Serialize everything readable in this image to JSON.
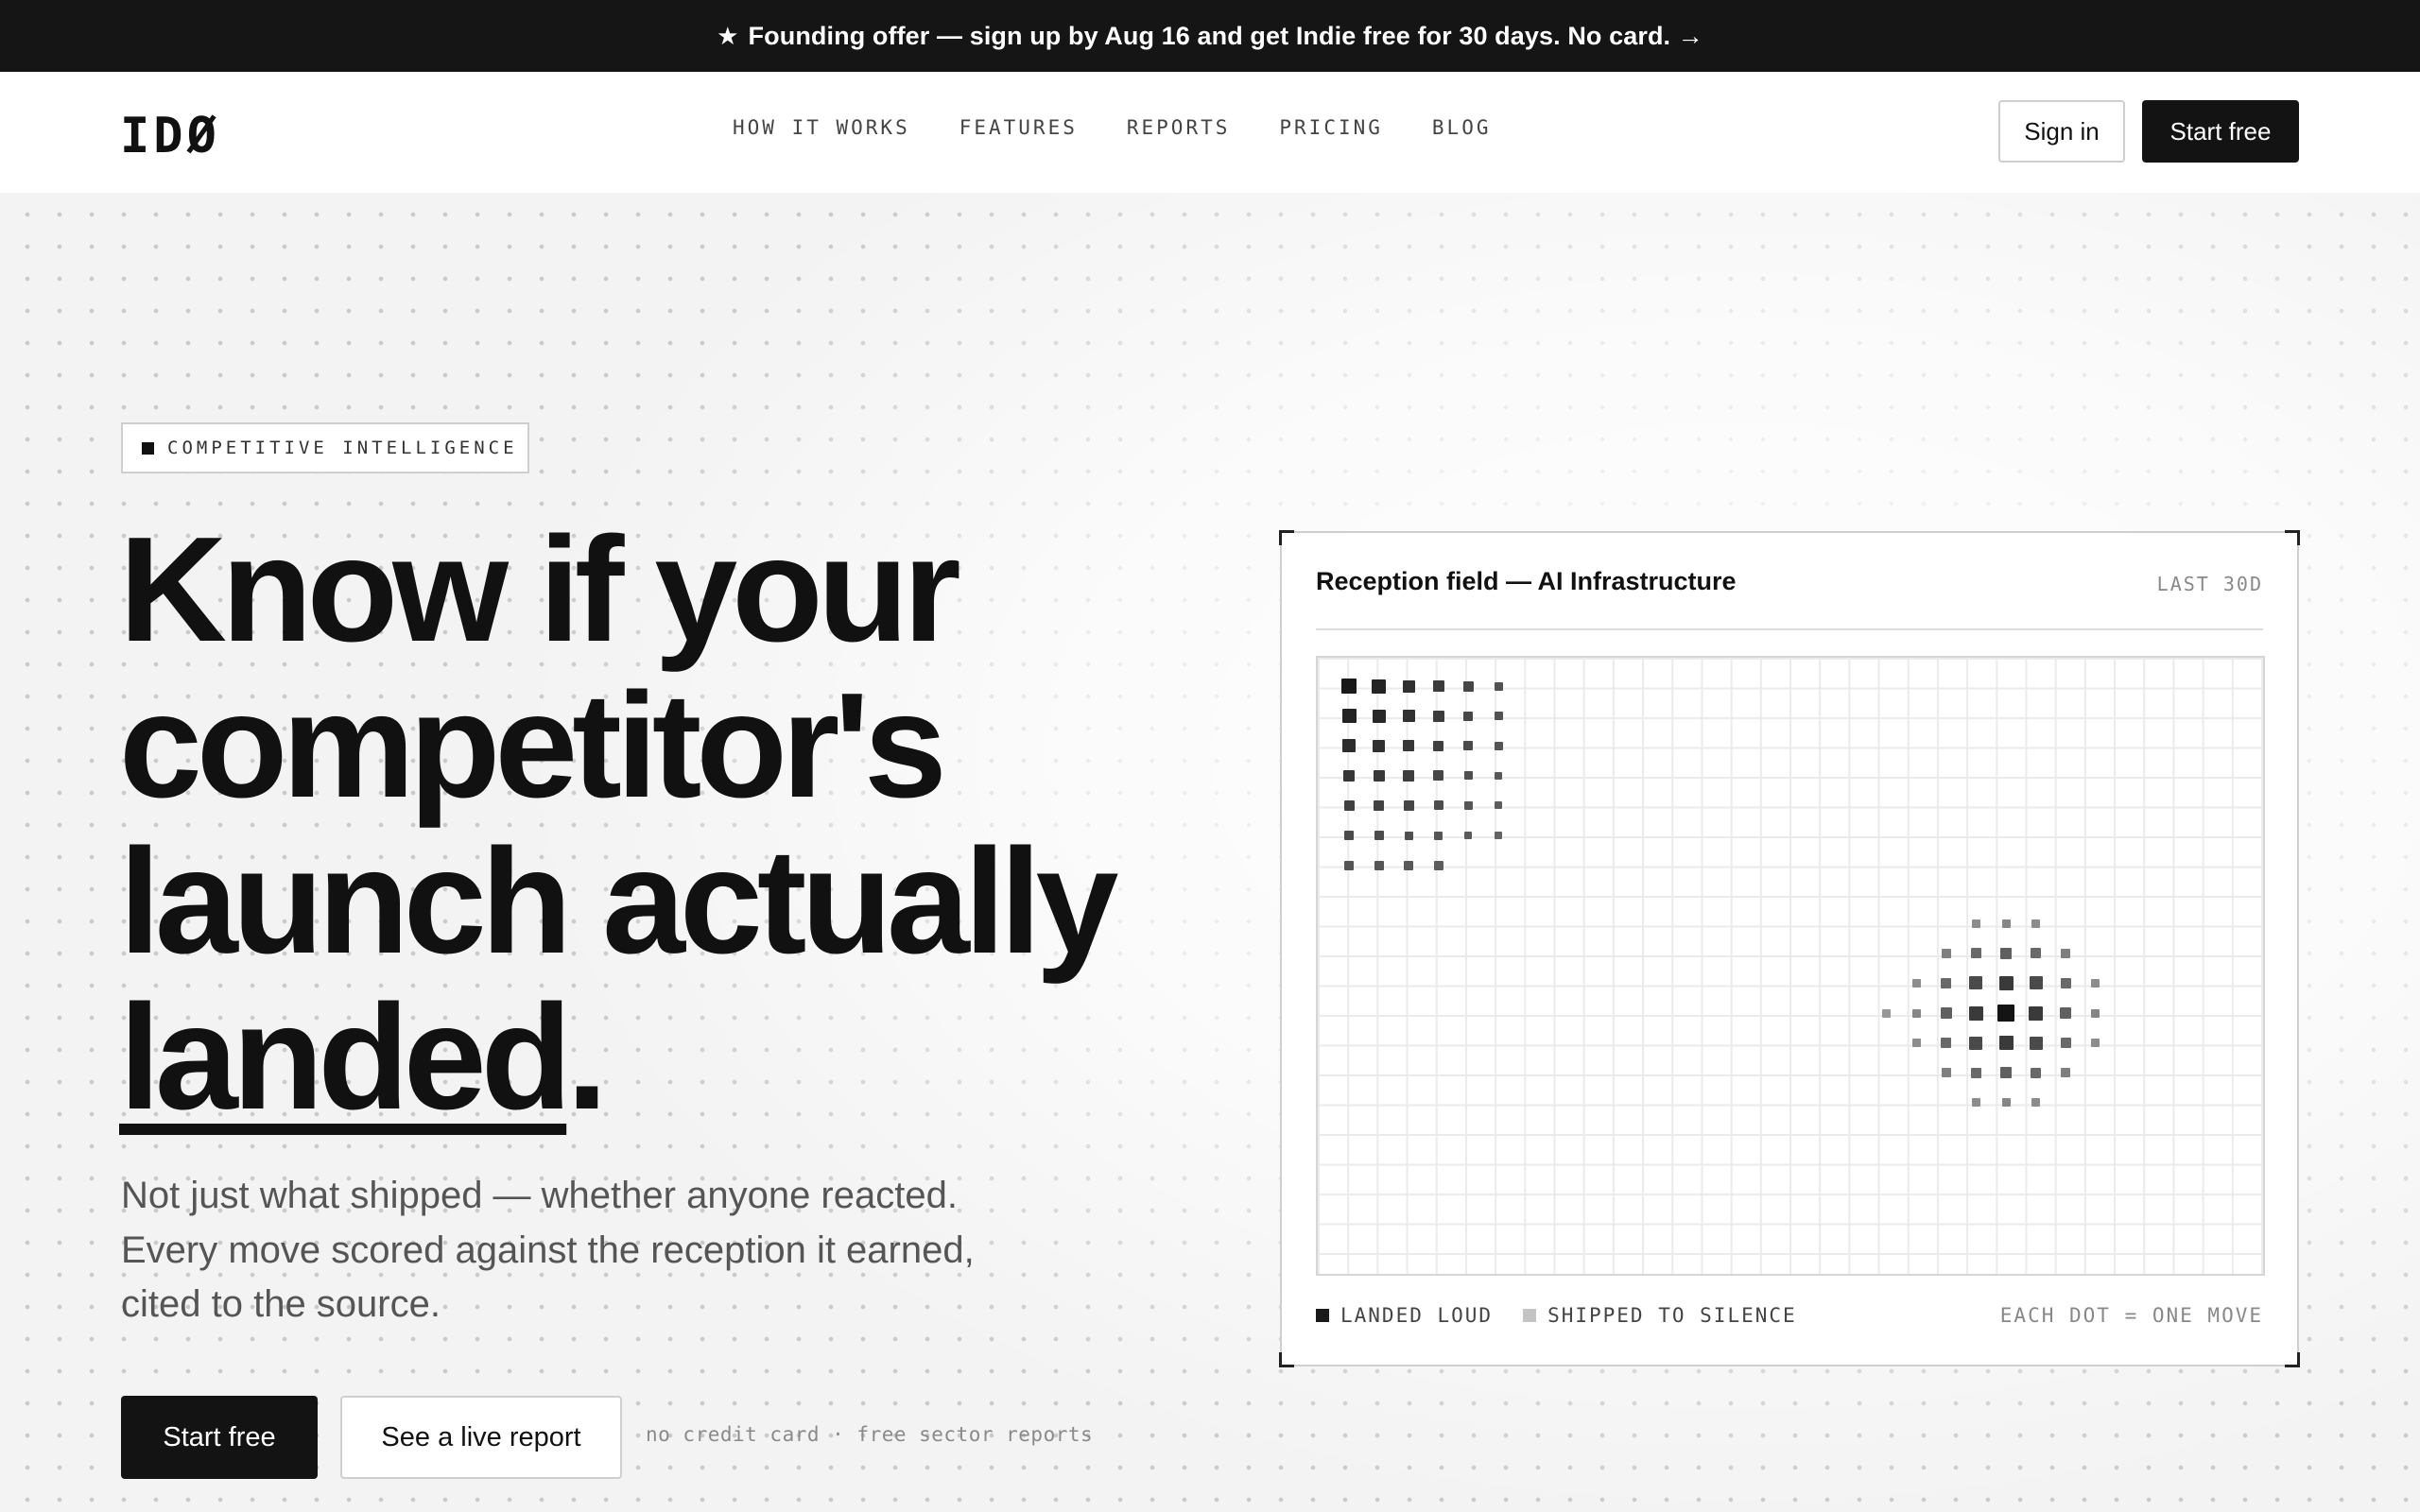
{
  "banner": {
    "icon": "star-icon",
    "text": "Founding offer — sign up by Aug 16 and get Indie free for 30 days. No card. →"
  },
  "nav": {
    "logo": "IDØ",
    "links": [
      "HOW IT WORKS",
      "FEATURES",
      "REPORTS",
      "PRICING",
      "BLOG"
    ],
    "sign_in": "Sign in",
    "start_free": "Start free"
  },
  "hero": {
    "eyebrow": "COMPETITIVE INTELLIGENCE",
    "headline": {
      "line1": "Know if your",
      "line2": "competitor's",
      "line3": "launch actually",
      "underlined": "landed",
      "punct": "."
    },
    "subtitle": "Not just what shipped — whether anyone reacted. Every move scored against the reception it earned, cited to the source.",
    "primary_cta": "Start free",
    "secondary_cta": "See a live report",
    "note": "no credit card · free sector reports"
  },
  "card": {
    "title": "Reception field — AI Infrastructure",
    "range": "LAST 30D",
    "legend": [
      {
        "label": "LANDED LOUD",
        "color": "#1a1a1a"
      },
      {
        "label": "SHIPPED TO SILENCE",
        "color": "#c4c4c4"
      }
    ],
    "footnote": "EACH DOT = ONE MOVE"
  },
  "colors": {
    "accent": "#111111",
    "banner_bg": "#151515"
  }
}
